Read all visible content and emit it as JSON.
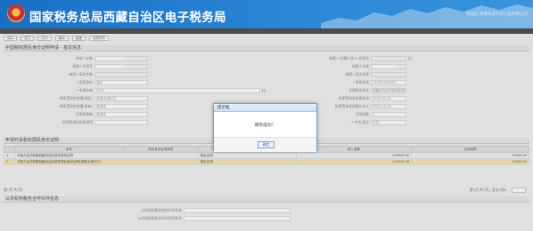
{
  "header": {
    "title": "国家税务总局西藏自治区电子税务局",
    "user": "欢迎您 西藏某某科技工程有限公司"
  },
  "toolbar": {
    "buttons": [
      "保存",
      "提交",
      "打印",
      "删除",
      "重置",
      "查看附件"
    ]
  },
  "sections": {
    "basic": "中国税收居民身份证明申请 - 基本信息",
    "table": "申请开具税收居民身份证明",
    "bottom": "公共机构税务合作伙伴信息"
  },
  "left_fields": [
    {
      "label": "申请人名称",
      "value": "",
      "redacted": true
    },
    {
      "label": "纳税人识别号",
      "value": "",
      "redacted": true
    },
    {
      "label": "纳税人英文名称",
      "value": ""
    },
    {
      "label": "* 居民身份",
      "value": "居民"
    },
    {
      "label": "* 申请年度",
      "value": "2020"
    },
    {
      "label": "拟享受协定待遇(地区)",
      "value": "英国/北爱尔兰"
    },
    {
      "label": "拟享受协定待遇(条款)",
      "value": "请选择"
    },
    {
      "label": "证明所属期",
      "value": "请选择"
    },
    {
      "label": "证明用途的具体说明",
      "value": ""
    }
  ],
  "right_fields": [
    {
      "label": "纳税人(扣缴义务人)识别号",
      "value": ""
    },
    {
      "label": "纳税人名称",
      "value": "",
      "redacted": true
    },
    {
      "label": "纳税人英文名称",
      "value": ""
    },
    {
      "label": "* 联系电话",
      "value": "1376235XXXX"
    },
    {
      "label": "主管税务机关",
      "value": "西藏自治区税务局某某区"
    },
    {
      "label": "拟享受协定所属年份",
      "value": "2020-01-01"
    },
    {
      "label": "拟享受协定所属年份止",
      "value": "2020-12-31"
    },
    {
      "label": "证明份数",
      "value": "1"
    },
    {
      "label": "* 中文/英文",
      "value": "中文"
    }
  ],
  "table": {
    "headers": [
      "",
      "序号",
      "居民身份证明类型",
      "居民身份证明份数",
      "收入金额",
      "应纳税额"
    ],
    "rows": [
      {
        "no": "1",
        "name": "中国人民共和国西藏自治区税收居民证明",
        "type": "居民证明",
        "amount": "100000.00",
        "tax": "10000.00",
        "selected": false
      },
      {
        "no": "2",
        "name": "中国人民共和国西藏自治区税收居民身份证明(英国/北爱尔兰)",
        "type": "居民证明",
        "amount": "100000.00",
        "tax": "10000.00",
        "selected": true
      }
    ]
  },
  "pager": {
    "left": "第1页 共1页",
    "right": "第1页 共1页 | 显示1到2"
  },
  "bottom_fields": [
    {
      "label": "公共机构税务合作伙伴名称",
      "value": ""
    },
    {
      "label": "公共机构税务合作伙伴识别号",
      "value": ""
    }
  ],
  "dialog": {
    "title": "提示框",
    "message": "保存成功！",
    "ok": "确定"
  }
}
